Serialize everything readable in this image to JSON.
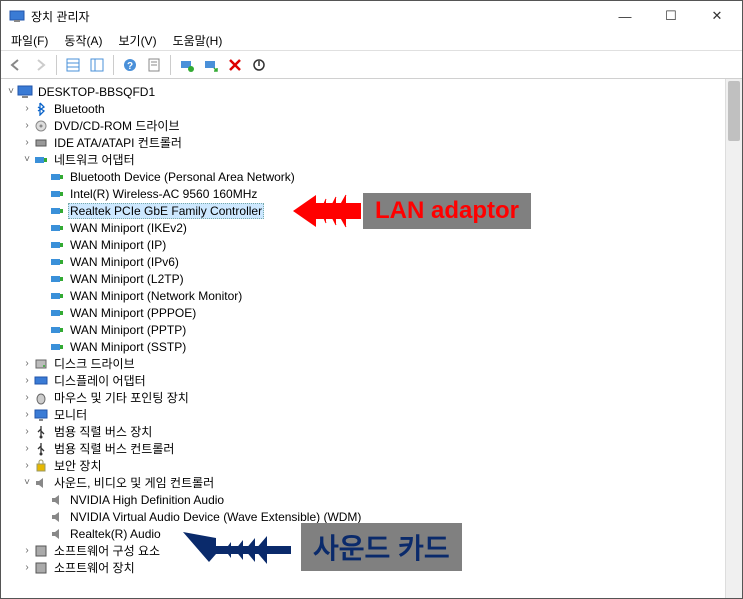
{
  "window": {
    "title": "장치 관리자",
    "btn_min": "—",
    "btn_max": "☐",
    "btn_close": "✕"
  },
  "menu": {
    "file": "파일(F)",
    "action": "동작(A)",
    "view": "보기(V)",
    "help": "도움말(H)"
  },
  "tree": {
    "root": "DESKTOP-BBSQFD1",
    "bluetooth": "Bluetooth",
    "dvd": "DVD/CD-ROM 드라이브",
    "ide": "IDE ATA/ATAPI 컨트롤러",
    "netadapter": "네트워크 어댑터",
    "net": {
      "i0": "Bluetooth Device (Personal Area Network)",
      "i1": "Intel(R) Wireless-AC 9560 160MHz",
      "i2": "Realtek PCIe GbE Family Controller",
      "i3": "WAN Miniport (IKEv2)",
      "i4": "WAN Miniport (IP)",
      "i5": "WAN Miniport (IPv6)",
      "i6": "WAN Miniport (L2TP)",
      "i7": "WAN Miniport (Network Monitor)",
      "i8": "WAN Miniport (PPPOE)",
      "i9": "WAN Miniport (PPTP)",
      "i10": "WAN Miniport (SSTP)"
    },
    "disk": "디스크 드라이브",
    "display": "디스플레이 어댑터",
    "mouse": "마우스 및 기타 포인팅 장치",
    "monitor": "모니터",
    "usb_dev": "범용 직렬 버스 장치",
    "usb_ctrl": "범용 직렬 버스 컨트롤러",
    "security": "보안 장치",
    "sound_cat": "사운드, 비디오 및 게임 컨트롤러",
    "sound": {
      "i0": "NVIDIA High Definition Audio",
      "i1": "NVIDIA Virtual Audio Device (Wave Extensible) (WDM)",
      "i2": "Realtek(R) Audio"
    },
    "sw_comp": "소프트웨어 구성 요소",
    "sw_dev": "소프트웨어 장치"
  },
  "annotations": {
    "lan": "LAN adaptor",
    "sound": "사운드 카드"
  },
  "colors": {
    "selection": "#cde8ff",
    "anno_bg": "#808080",
    "anno_red": "#ff0000",
    "anno_navy": "#0a2a6b"
  }
}
